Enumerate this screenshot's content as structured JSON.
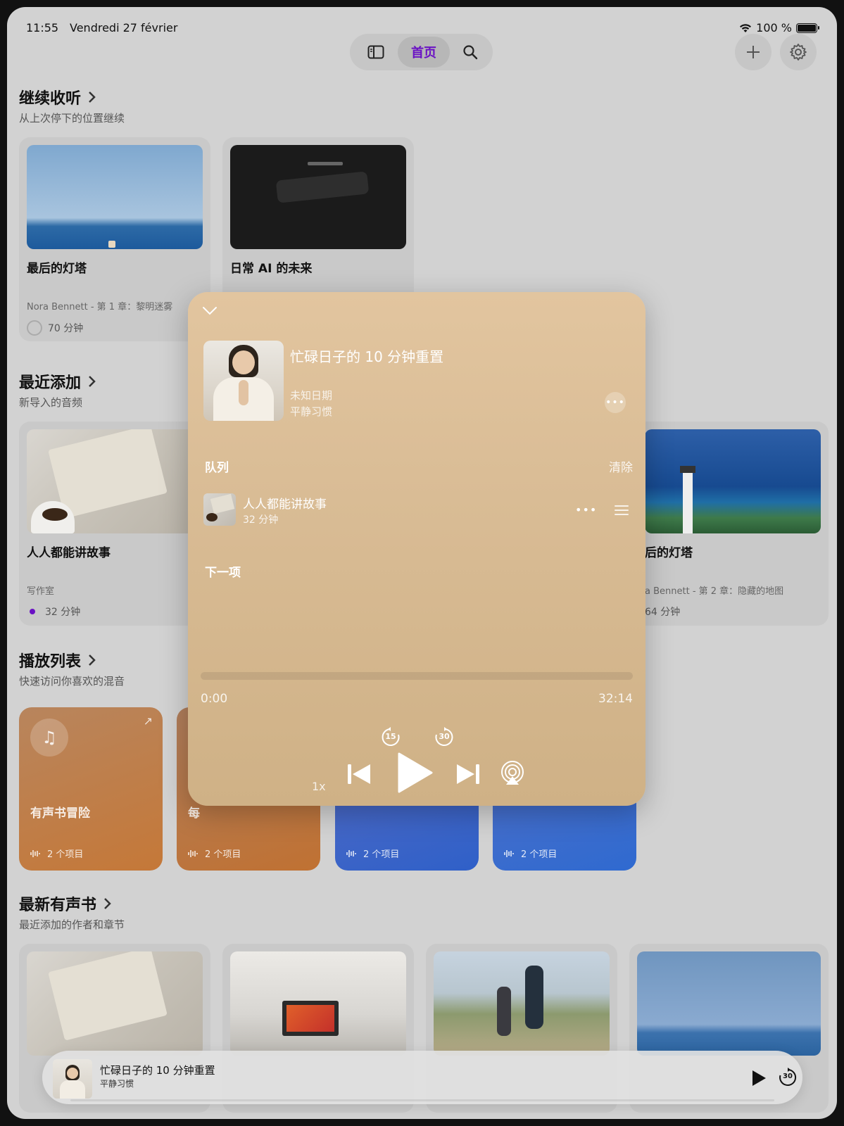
{
  "status": {
    "time": "11:55",
    "date": "Vendredi 27 février",
    "battery": "100 %"
  },
  "nav": {
    "home_label": "首页"
  },
  "continue": {
    "title": "继续收听",
    "subtitle": "从上次停下的位置继续",
    "items": [
      {
        "title": "最后的灯塔",
        "meta": "Nora Bennett - 第 1 章：黎明迷雾",
        "duration": "70 分钟"
      },
      {
        "title": "日常 AI 的未来"
      }
    ]
  },
  "recent": {
    "title": "最近添加",
    "subtitle": "新导入的音频",
    "items": [
      {
        "title": "人人都能讲故事",
        "meta": "写作室",
        "duration": "32 分钟"
      },
      {
        "title": "后的灯塔",
        "meta": "a Bennett - 第 2 章：隐藏的地图",
        "duration": "64 分钟"
      }
    ]
  },
  "playlists": {
    "title": "播放列表",
    "subtitle": "快速访问你喜欢的混音",
    "items": [
      {
        "title": "有声书冒险",
        "count": "2 个项目",
        "color": "#c77f45"
      },
      {
        "title": "每",
        "count": "2 个项目",
        "color": "#c27840"
      },
      {
        "title": "",
        "count": "2 个项目",
        "color": "#3f64c9"
      },
      {
        "title": "",
        "count": "2 个项目",
        "color": "#3f6ccf"
      }
    ]
  },
  "audiobooks": {
    "title": "最新有声书",
    "subtitle": "最近添加的作者和章节"
  },
  "player": {
    "title": "忙碌日子的 10 分钟重置",
    "date": "未知日期",
    "category": "平静习惯",
    "queue_heading": "队列",
    "clear_label": "清除",
    "queue_items": [
      {
        "title": "人人都能讲故事",
        "duration": "32 分钟"
      }
    ],
    "next_heading": "下一项",
    "time_current": "0:00",
    "time_total": "32:14",
    "progress": 0,
    "skip_back": "15",
    "skip_forward": "30",
    "speed": "1x"
  },
  "mini_player": {
    "title": "忙碌日子的 10 分钟重置",
    "subtitle": "平静习惯",
    "skip_forward": "30"
  },
  "colors": {
    "accent": "#6a12c4"
  }
}
